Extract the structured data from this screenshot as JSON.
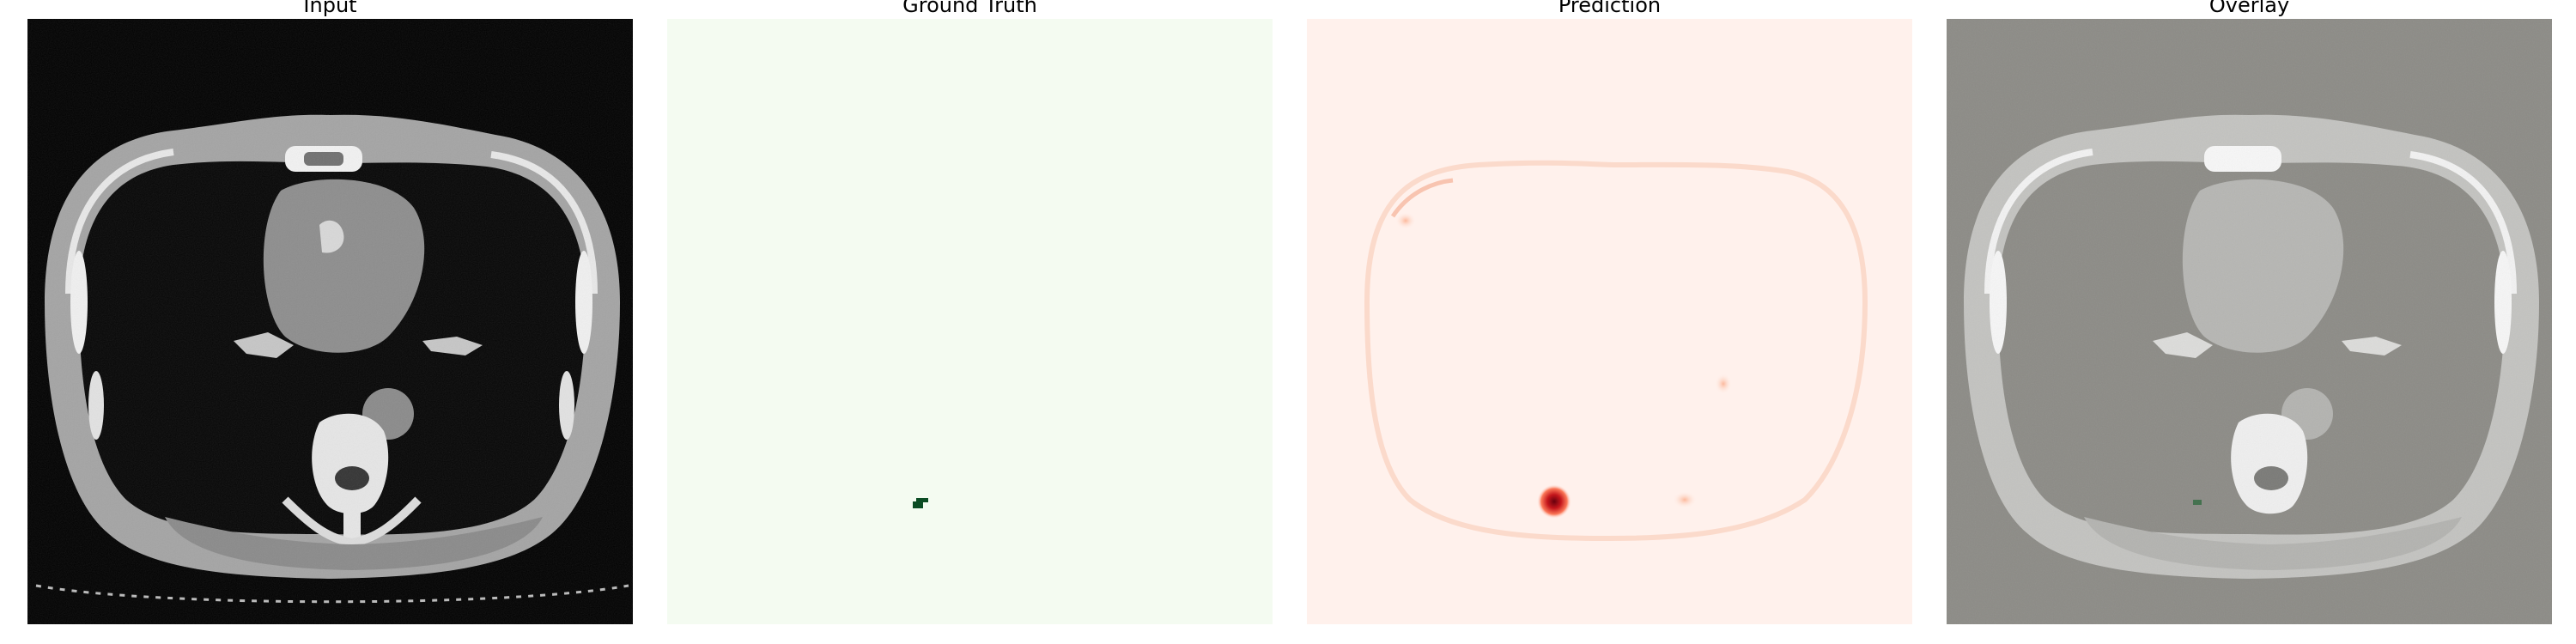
{
  "panels": [
    {
      "title": "Input"
    },
    {
      "title": "Ground Truth"
    },
    {
      "title": "Prediction"
    },
    {
      "title": "Overlay"
    }
  ],
  "colors": {
    "input_bg": "#000000",
    "ground_truth_bg": "#f4fbf1",
    "ground_truth_mark": "#0b4c24",
    "prediction_bg": "#fff1ec",
    "prediction_peak": "#a1000d",
    "overlay_bg": "#8c8b86"
  }
}
